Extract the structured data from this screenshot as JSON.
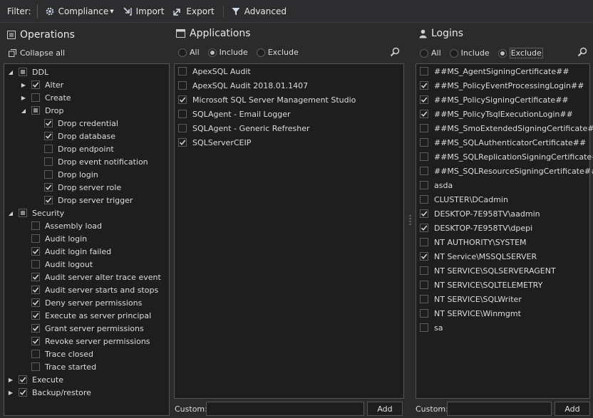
{
  "toolbar": {
    "filter_label": "Filter:",
    "compliance_label": "Compliance",
    "import_label": "Import",
    "export_label": "Export",
    "advanced_label": "Advanced"
  },
  "operations": {
    "title": "Operations",
    "collapse_all": "Collapse all",
    "tree": [
      {
        "label": "DDL",
        "level": 0,
        "arrow": "expanded",
        "state": "partial"
      },
      {
        "label": "Alter",
        "level": 1,
        "arrow": "collapsed",
        "state": "checked"
      },
      {
        "label": "Create",
        "level": 1,
        "arrow": "collapsed",
        "state": "unchecked"
      },
      {
        "label": "Drop",
        "level": 1,
        "arrow": "expanded",
        "state": "partial"
      },
      {
        "label": "Drop credential",
        "level": 2,
        "arrow": "none",
        "state": "checked"
      },
      {
        "label": "Drop database",
        "level": 2,
        "arrow": "none",
        "state": "checked"
      },
      {
        "label": "Drop endpoint",
        "level": 2,
        "arrow": "none",
        "state": "unchecked"
      },
      {
        "label": "Drop event notification",
        "level": 2,
        "arrow": "none",
        "state": "unchecked"
      },
      {
        "label": "Drop login",
        "level": 2,
        "arrow": "none",
        "state": "unchecked"
      },
      {
        "label": "Drop server role",
        "level": 2,
        "arrow": "none",
        "state": "checked"
      },
      {
        "label": "Drop server trigger",
        "level": 2,
        "arrow": "none",
        "state": "checked"
      },
      {
        "label": "Security",
        "level": 0,
        "arrow": "expanded",
        "state": "partial"
      },
      {
        "label": "Assembly load",
        "level": 1,
        "arrow": "none",
        "state": "unchecked"
      },
      {
        "label": "Audit login",
        "level": 1,
        "arrow": "none",
        "state": "unchecked"
      },
      {
        "label": "Audit login failed",
        "level": 1,
        "arrow": "none",
        "state": "checked"
      },
      {
        "label": "Audit logout",
        "level": 1,
        "arrow": "none",
        "state": "unchecked"
      },
      {
        "label": "Audit server alter trace event",
        "level": 1,
        "arrow": "none",
        "state": "checked"
      },
      {
        "label": "Audit server starts and stops",
        "level": 1,
        "arrow": "none",
        "state": "checked"
      },
      {
        "label": "Deny server permissions",
        "level": 1,
        "arrow": "none",
        "state": "checked"
      },
      {
        "label": "Execute as server principal",
        "level": 1,
        "arrow": "none",
        "state": "checked"
      },
      {
        "label": "Grant server permissions",
        "level": 1,
        "arrow": "none",
        "state": "checked"
      },
      {
        "label": "Revoke server permissions",
        "level": 1,
        "arrow": "none",
        "state": "checked"
      },
      {
        "label": "Trace closed",
        "level": 1,
        "arrow": "none",
        "state": "unchecked"
      },
      {
        "label": "Trace started",
        "level": 1,
        "arrow": "none",
        "state": "unchecked"
      },
      {
        "label": "Execute",
        "level": 0,
        "arrow": "collapsed",
        "state": "checked"
      },
      {
        "label": "Backup/restore",
        "level": 0,
        "arrow": "collapsed",
        "state": "checked"
      }
    ]
  },
  "applications": {
    "title": "Applications",
    "radio": {
      "all": "All",
      "include": "Include",
      "exclude": "Exclude",
      "selected": "include"
    },
    "items": [
      {
        "label": "ApexSQL Audit",
        "checked": false
      },
      {
        "label": "ApexSQL Audit 2018.01.1407",
        "checked": false
      },
      {
        "label": "Microsoft SQL Server Management Studio",
        "checked": true
      },
      {
        "label": "SQLAgent - Email Logger",
        "checked": false
      },
      {
        "label": "SQLAgent - Generic Refresher",
        "checked": false
      },
      {
        "label": "SQLServerCEIP",
        "checked": true
      }
    ],
    "custom_label": "Custom:",
    "custom_value": "",
    "add_label": "Add"
  },
  "logins": {
    "title": "Logins",
    "radio": {
      "all": "All",
      "include": "Include",
      "exclude": "Exclude",
      "selected": "exclude"
    },
    "items": [
      {
        "label": "##MS_AgentSigningCertificate##",
        "checked": false
      },
      {
        "label": "##MS_PolicyEventProcessingLogin##",
        "checked": true
      },
      {
        "label": "##MS_PolicySigningCertificate##",
        "checked": true
      },
      {
        "label": "##MS_PolicyTsqlExecutionLogin##",
        "checked": true
      },
      {
        "label": "##MS_SmoExtendedSigningCertificate##",
        "checked": false
      },
      {
        "label": "##MS_SQLAuthenticatorCertificate##",
        "checked": false
      },
      {
        "label": "##MS_SQLReplicationSigningCertificate##",
        "checked": false
      },
      {
        "label": "##MS_SQLResourceSigningCertificate##",
        "checked": false
      },
      {
        "label": "asda",
        "checked": false
      },
      {
        "label": "CLUSTER\\DCadmin",
        "checked": false
      },
      {
        "label": "DESKTOP-7E958TV\\aadmin",
        "checked": true
      },
      {
        "label": "DESKTOP-7E958TV\\dpepi",
        "checked": true
      },
      {
        "label": "NT AUTHORITY\\SYSTEM",
        "checked": false
      },
      {
        "label": "NT Service\\MSSQLSERVER",
        "checked": true
      },
      {
        "label": "NT SERVICE\\SQLSERVERAGENT",
        "checked": false
      },
      {
        "label": "NT SERVICE\\SQLTELEMETRY",
        "checked": false
      },
      {
        "label": "NT SERVICE\\SQLWriter",
        "checked": false
      },
      {
        "label": "NT SERVICE\\Winmgmt",
        "checked": false
      },
      {
        "label": "sa",
        "checked": false
      }
    ],
    "custom_label": "Custom:",
    "custom_value": "",
    "add_label": "Add"
  }
}
